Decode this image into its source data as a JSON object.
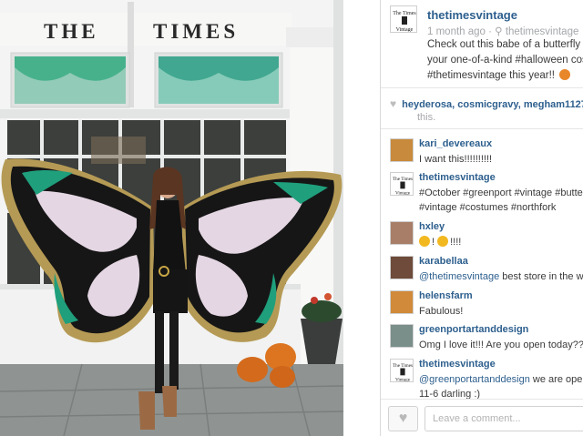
{
  "post": {
    "username": "thetimesvintage",
    "time_ago": "1 month ago",
    "location": "thetimesvintage",
    "caption_line1": "Check out this babe of a butterfly ",
    "caption_line1_link": "@",
    "caption_line2": "your one-of-a-kind #halloween cost",
    "caption_line3": "#thetimesvintage this year!! "
  },
  "photo": {
    "sign_left": "THE",
    "sign_right": "TIMES"
  },
  "likes": {
    "users": "heyderosa, cosmicgravy, megham1127",
    "suffix": "this."
  },
  "comments": [
    {
      "user": "kari_devereaux",
      "text": "I want this!!!!!!!!!!"
    },
    {
      "user": "thetimesvintage",
      "line1": "#October #greenport #vintage #butte",
      "line2": "#vintage #costumes #northfork"
    },
    {
      "user": "hxley",
      "text": "!!!!"
    },
    {
      "user": "karabellaa",
      "link": "@thetimesvintage",
      "text": " best store in the wo"
    },
    {
      "user": "helensfarm",
      "text": "Fabulous!"
    },
    {
      "user": "greenportartanddesign",
      "text": "Omg I love it!!! Are you open today??"
    },
    {
      "user": "thetimesvintage",
      "link": "@greenportartanddesign",
      "text": " we are open",
      "line2": "11-6 darling :)"
    }
  ],
  "footer": {
    "comment_placeholder": "Leave a comment..."
  },
  "icons": {
    "heart": "heart-icon",
    "location": "location-pin-icon"
  }
}
